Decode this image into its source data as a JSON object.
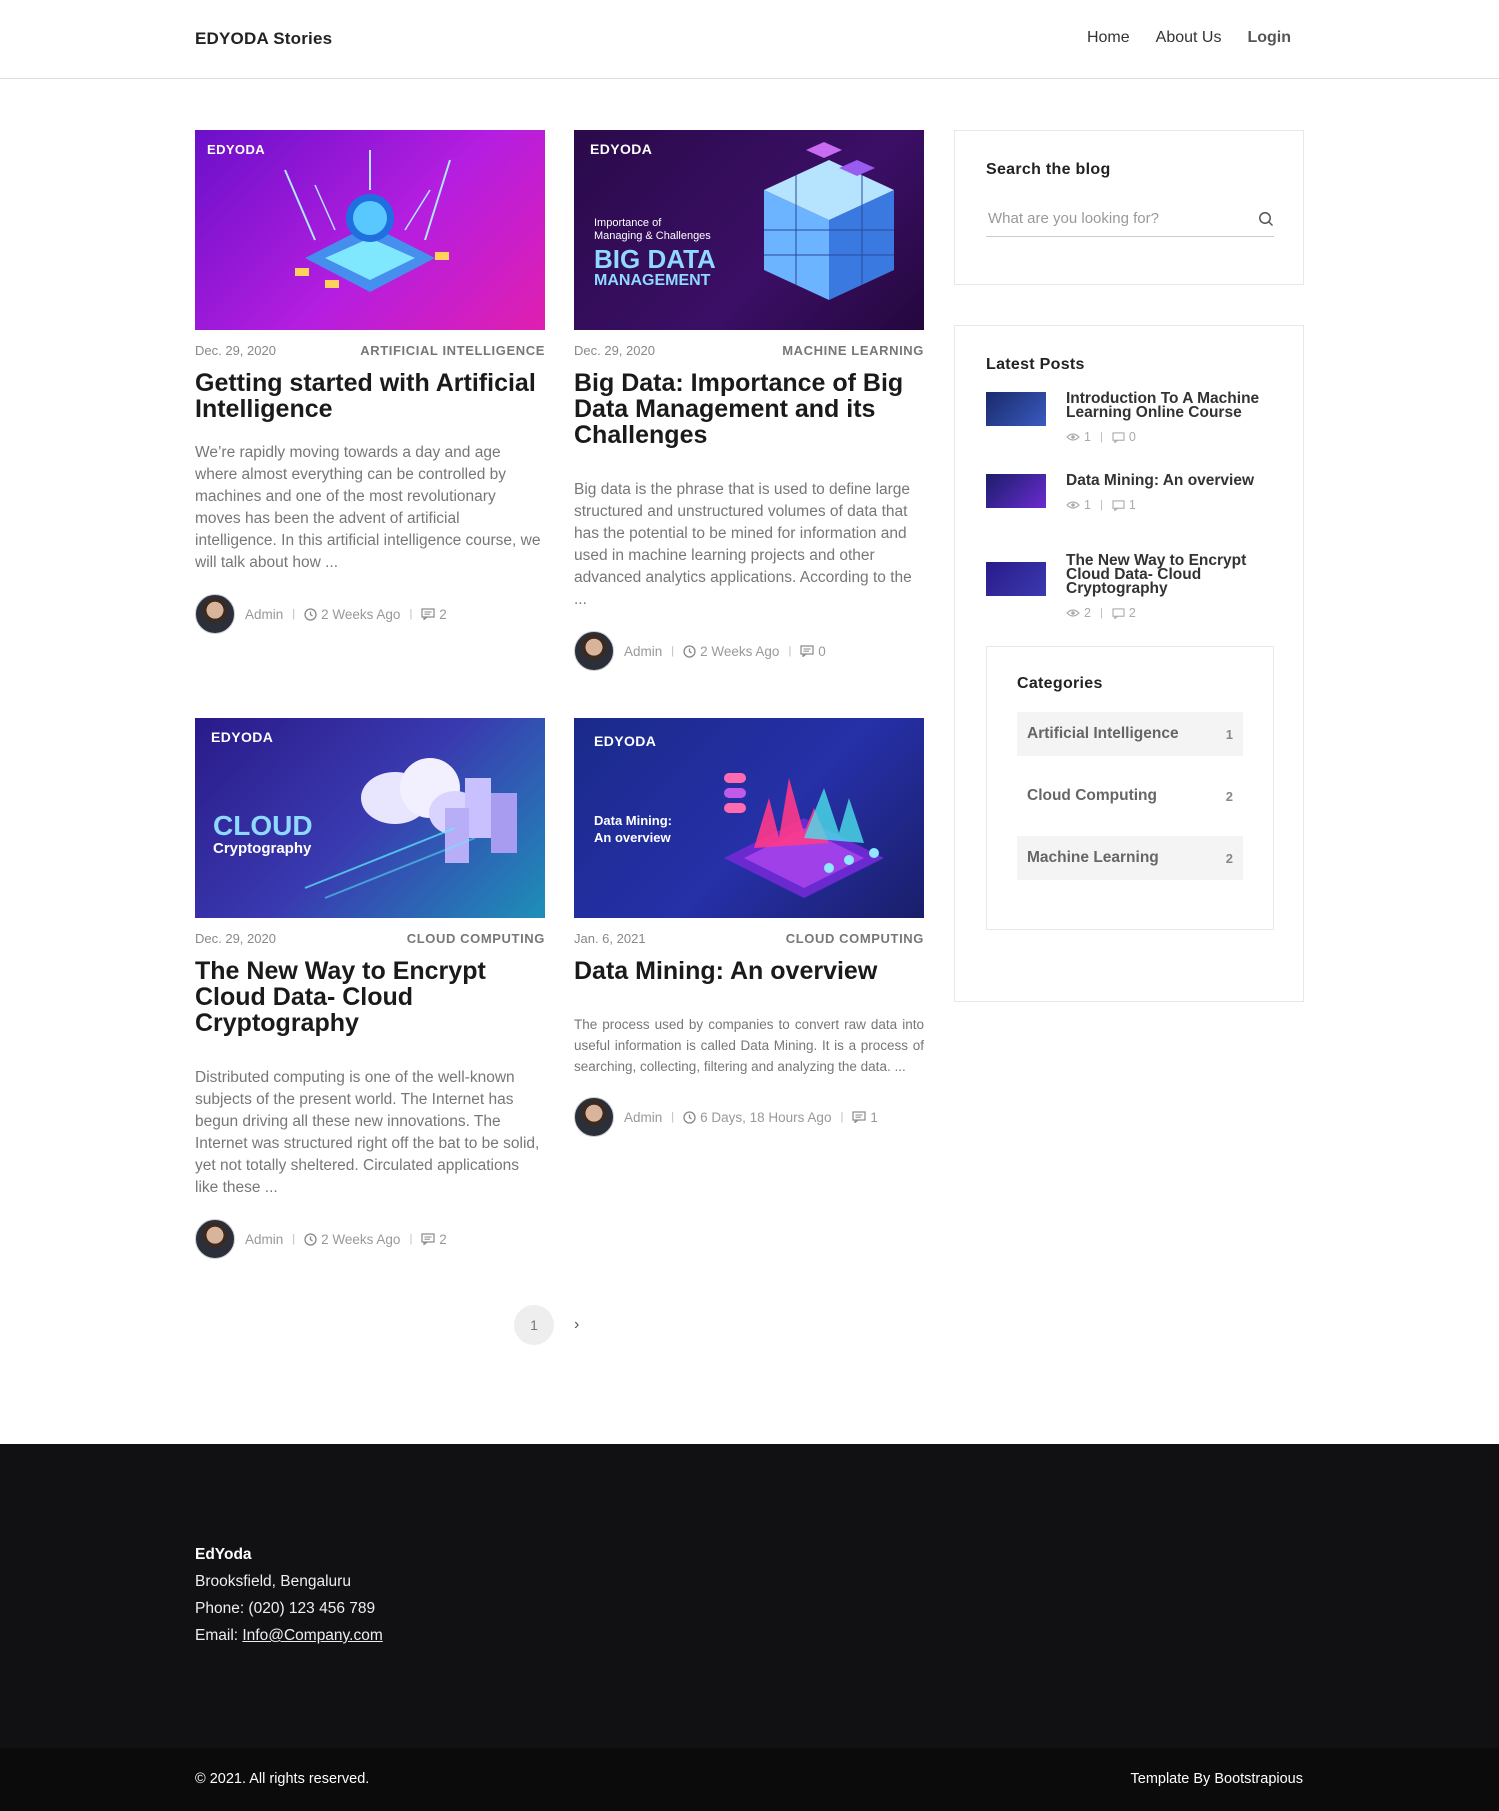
{
  "navbar": {
    "brand": "EDYODA Stories",
    "links": [
      "Home",
      "About Us",
      "Login"
    ]
  },
  "posts": [
    {
      "date": "Dec. 29, 2020",
      "category": "ARTIFICIAL INTELLIGENCE",
      "title": "Getting started with Artificial Intelligence",
      "excerpt": "We’re rapidly moving towards a day and age where almost everything can be controlled by machines and one of the most revolutionary moves has been the advent of artificial intelligence. In this artificial intelligence course, we will talk about how ...",
      "author": "Admin",
      "time": "2 Weeks Ago",
      "comments": "2",
      "image": {
        "logo": "EDYODA",
        "line1": "",
        "line2": ""
      }
    },
    {
      "date": "Dec. 29, 2020",
      "category": "MACHINE LEARNING",
      "title": "Big Data: Importance of Big Data Management and its Challenges",
      "excerpt": "Big data is the phrase that is used to define large structured and unstructured volumes of data that has the potential to be mined for information and used in machine learning projects and other advanced analytics applications. According to the ...",
      "author": "Admin",
      "time": "2 Weeks Ago",
      "comments": "0",
      "image": {
        "logo": "EDYODA",
        "small1": "Importance of",
        "small2": "Managing & Challenges",
        "big1": "BIG DATA",
        "big2": "MANAGEMENT"
      }
    },
    {
      "date": "Dec. 29, 2020",
      "category": "CLOUD COMPUTING",
      "title": "The New Way to Encrypt Cloud Data- Cloud Cryptography",
      "excerpt": "Distributed computing is one of the well-known subjects of the present world. The Internet has begun driving all these new innovations. The Internet was structured right off the bat to be solid, yet not totally sheltered. Circulated applications like these ...",
      "author": "Admin",
      "time": "2 Weeks Ago",
      "comments": "2",
      "image": {
        "logo": "EDYODA",
        "big1": "CLOUD",
        "small1": "Cryptography"
      }
    },
    {
      "date": "Jan. 6, 2021",
      "category": "CLOUD COMPUTING",
      "title": "Data Mining: An overview",
      "excerpt": "The process used by companies to convert raw data into useful information is called Data Mining. It is a process of searching, collecting, filtering and analyzing the data. ...",
      "author": "Admin",
      "time": "6 Days, 18 Hours Ago",
      "comments": "1",
      "image": {
        "logo": "EDYODA",
        "small1": "Data Mining:",
        "small2": "An overview"
      }
    }
  ],
  "pagination": {
    "current": "1",
    "next": "›"
  },
  "sidebar": {
    "search": {
      "title": "Search the blog",
      "placeholder": "What are you looking for?"
    },
    "latest": {
      "title": "Latest Posts",
      "items": [
        {
          "title": "Introduction To A Machine Learning Online Course",
          "views": "1",
          "comments": "0"
        },
        {
          "title": "Data Mining: An overview",
          "views": "1",
          "comments": "1"
        },
        {
          "title": "The New Way to Encrypt Cloud Data- Cloud Cryptography",
          "views": "2",
          "comments": "2"
        }
      ]
    },
    "categories": {
      "title": "Categories",
      "items": [
        {
          "name": "Artificial Intelligence",
          "count": "1"
        },
        {
          "name": "Cloud Computing",
          "count": "2"
        },
        {
          "name": "Machine Learning",
          "count": "2"
        }
      ]
    }
  },
  "footer": {
    "name": "EdYoda",
    "address": "Brooksfield, Bengaluru",
    "phone": "Phone: (020) 123 456 789",
    "email_label": "Email: ",
    "email": "Info@Company.com",
    "copyright": "© 2021. All rights reserved.",
    "credit_prefix": "Template By ",
    "credit_name": "Bootstrapious"
  },
  "colors": {
    "accent": "#1a1a1a",
    "footer_bg": "#111113"
  }
}
